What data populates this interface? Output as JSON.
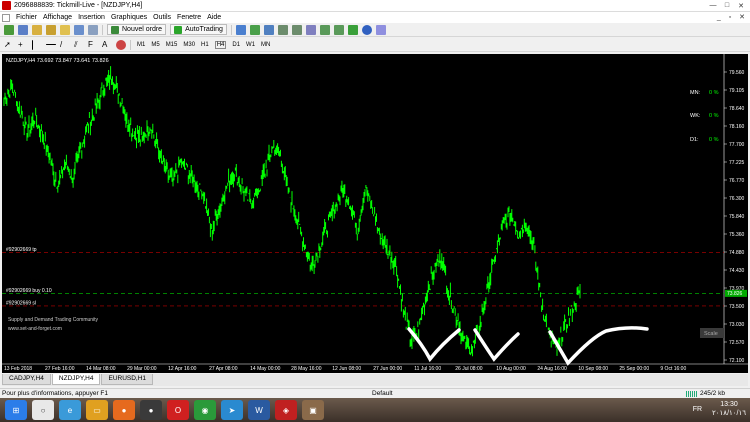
{
  "window": {
    "title": "2096888839: Tickmill-Live - [NZDJPY,H4]"
  },
  "menu": {
    "items": [
      "Fichier",
      "Affichage",
      "Insertion",
      "Graphiques",
      "Outils",
      "Fenetre",
      "Aide"
    ]
  },
  "toolbar": {
    "new_order_label": "Nouvel ordre",
    "autotrading_label": "AutoTrading",
    "timeframes": [
      "M1",
      "M5",
      "M15",
      "M30",
      "H1",
      "H4",
      "D1",
      "W1",
      "MN"
    ]
  },
  "chart": {
    "header": "NZDJPY,H4  73.692 73.847 73.641 73.826",
    "line_tp_label": "#92902669 tp",
    "line_buy_label": "#92902669 buy 0.10",
    "line_sl_label": "#92902669 sl",
    "current_price": "73.826",
    "scale_label": "Scale",
    "watermark_1": "Supply and Demand Trading Community",
    "watermark_2": "www.set-and-forget.com",
    "indicators": [
      {
        "label": "MN:",
        "value": "0 %"
      },
      {
        "label": "WK:",
        "value": "0 %"
      },
      {
        "label": "D1:",
        "value": "0 %"
      }
    ],
    "price_ticks": [
      "79.560",
      "79.105",
      "78.640",
      "78.160",
      "77.700",
      "77.225",
      "76.770",
      "76.300",
      "75.840",
      "75.360",
      "74.880",
      "74.430",
      "73.970",
      "73.500",
      "73.030",
      "72.570",
      "72.100"
    ],
    "time_ticks": [
      "13 Feb 2018",
      "27 Feb 16:00",
      "14 Mar 08:00",
      "29 Mar 00:00",
      "12 Apr 16:00",
      "27 Apr 08:00",
      "14 May 00:00",
      "28 May 16:00",
      "12 Jun 08:00",
      "27 Jun 00:00",
      "11 Jul 16:00",
      "26 Jul 08:00",
      "10 Aug 00:00",
      "24 Aug 16:00",
      "10 Sep 08:00",
      "25 Sep 00:00",
      "9 Oct 16:00"
    ],
    "colors": {
      "bg": "#000000",
      "candles": "#00ff00",
      "tp_sl": "#c00000",
      "buy": "#00aa00",
      "annotation": "#ffffff"
    }
  },
  "chart_data": {
    "type": "line",
    "symbol": "NZDJPY",
    "timeframe": "H4",
    "ylim": [
      72.1,
      79.56
    ],
    "x_range": [
      "13 Feb 2018",
      "9 Oct 16:00"
    ],
    "levels": {
      "tp": 74.88,
      "buy": 73.826,
      "sl": 73.5
    },
    "series": [
      {
        "values": [
          78.8,
          79.2,
          78.6,
          78.0,
          78.4,
          77.9,
          77.3,
          76.6,
          77.2,
          76.8,
          77.6,
          78.2,
          78.6,
          79.2,
          79.45,
          79.0,
          78.3,
          78.0,
          77.8,
          78.2,
          77.6,
          77.0,
          76.7,
          77.2,
          77.0,
          76.6,
          76.4,
          75.4,
          76.0,
          76.6,
          77.0,
          76.6,
          76.2,
          76.4,
          77.0,
          77.6,
          77.4,
          76.5,
          75.8,
          75.2,
          74.5,
          75.0,
          75.5,
          76.0,
          76.5,
          76.2,
          75.5,
          76.5,
          76.0,
          75.3,
          74.9,
          74.6,
          73.4,
          72.6,
          72.9,
          73.8,
          74.4,
          74.8,
          73.8,
          73.2,
          72.5,
          72.4,
          73.0,
          74.0,
          74.8,
          75.6,
          75.9,
          75.4,
          75.7,
          75.0,
          73.6,
          72.7,
          72.4,
          72.9,
          73.4,
          73.85
        ]
      }
    ]
  },
  "tabs": [
    "CADJPY,H4",
    "NZDJPY,H4",
    "EURUSD,H1"
  ],
  "status": {
    "help": "Pour plus d'informations, appuyer F1",
    "profile": "Default",
    "traffic": "245/2 kb"
  },
  "taskbar": {
    "lang": "FR",
    "time": "13:30",
    "date": "٢٠١٨/١٠/١٦"
  }
}
